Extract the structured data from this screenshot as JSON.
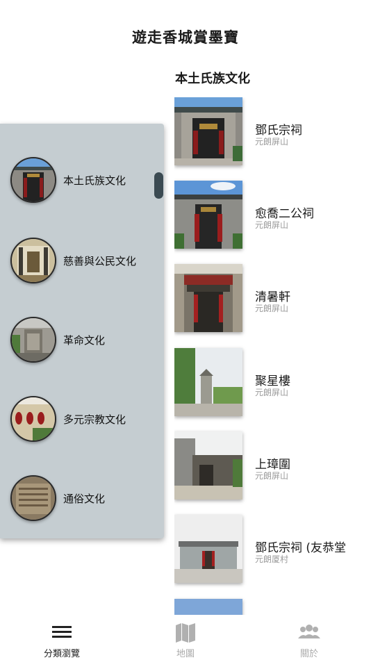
{
  "header": {
    "title": "遊走香城賞墨寶"
  },
  "section": {
    "title": "本土氏族文化"
  },
  "places": [
    {
      "name": "鄧氏宗祠",
      "area": "元朗屏山"
    },
    {
      "name": "愈喬二公祠",
      "area": "元朗屏山"
    },
    {
      "name": "清暑軒",
      "area": "元朗屏山"
    },
    {
      "name": "聚星樓",
      "area": "元朗屏山"
    },
    {
      "name": "上璋圍",
      "area": "元朗屏山"
    },
    {
      "name": "鄧氏宗祠 (友恭堂",
      "area": "元朗厦村"
    }
  ],
  "categories": [
    {
      "label": "本土氏族文化"
    },
    {
      "label": "慈善與公民文化"
    },
    {
      "label": "革命文化"
    },
    {
      "label": "多元宗教文化"
    },
    {
      "label": "通俗文化"
    }
  ],
  "tabs": [
    {
      "label": "分類瀏覽",
      "icon": "menu-icon",
      "active": true
    },
    {
      "label": "地圖",
      "icon": "map-icon",
      "active": false
    },
    {
      "label": "關於",
      "icon": "people-icon",
      "active": false
    }
  ],
  "colors": {
    "drawer_bg": "#c5cdd1",
    "handle": "#3b4a52",
    "active_tab": "#222222",
    "inactive_tab": "#aaaaaa"
  }
}
